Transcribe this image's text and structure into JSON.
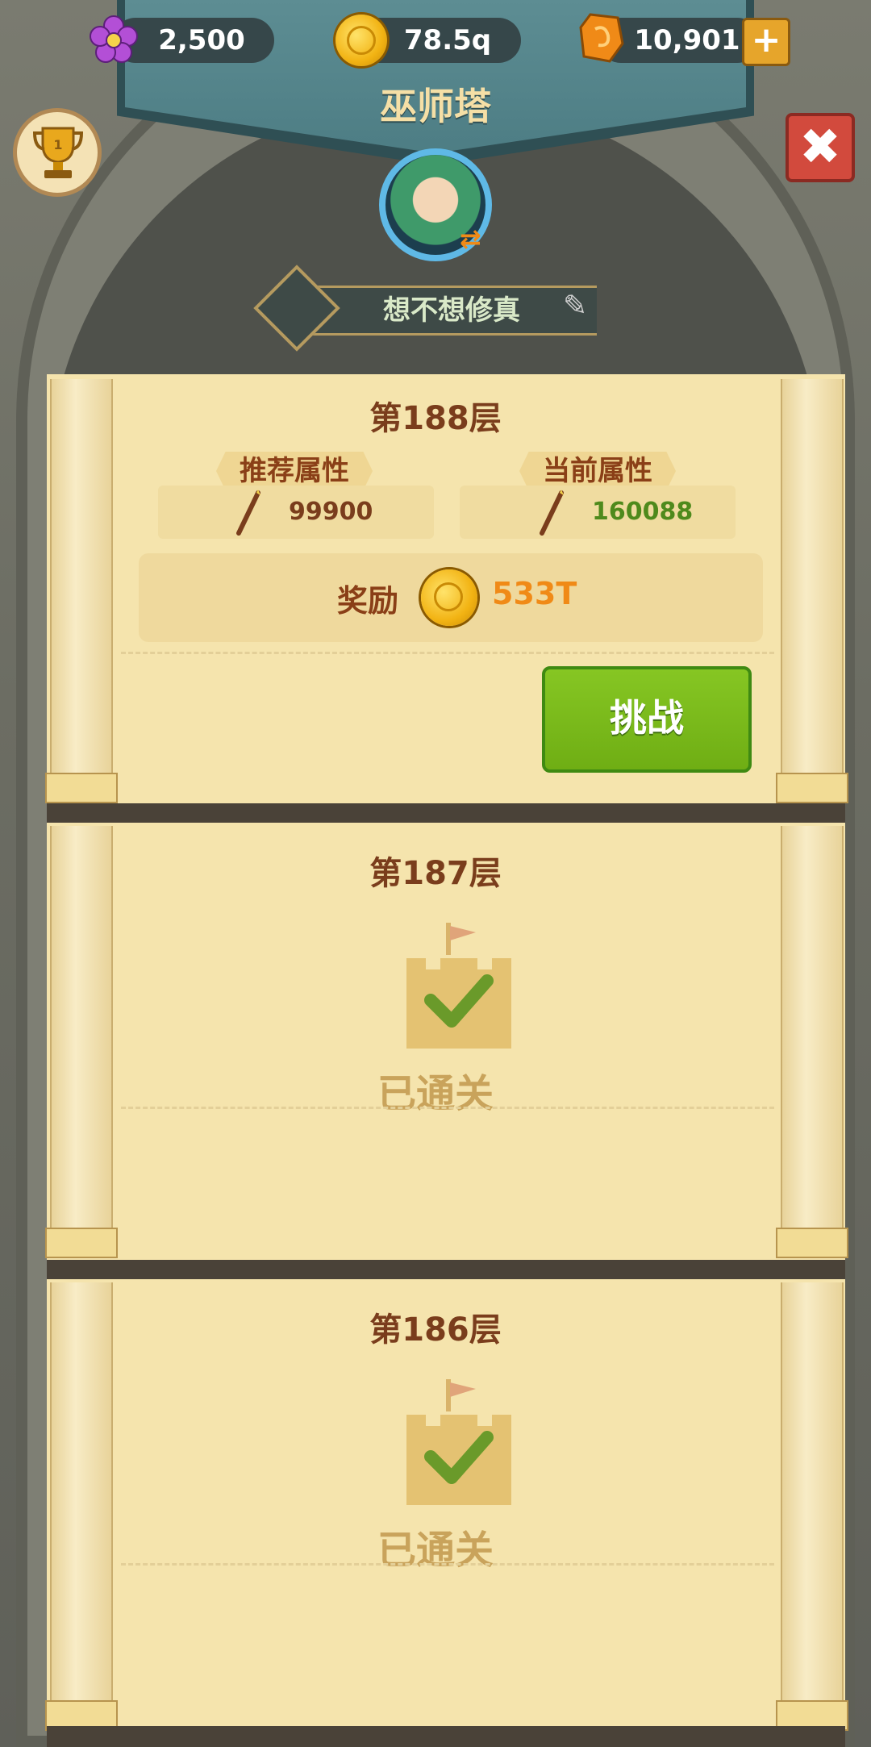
{
  "header": {
    "title": "巫师塔",
    "currencies": [
      {
        "icon": "flower-gem-icon",
        "value": "2,500"
      },
      {
        "icon": "gold-coin-icon",
        "value": "78.5q"
      },
      {
        "icon": "orange-gem-icon",
        "value": "10,901"
      }
    ],
    "add_label": "+",
    "close_label": "✖",
    "player_name": "想不想修真",
    "edit_icon": "✎"
  },
  "floors": [
    {
      "title": "第188层",
      "recommended_label": "推荐属性",
      "recommended_value": "99900",
      "current_label": "当前属性",
      "current_value": "160088",
      "reward_label": "奖励",
      "reward_value": "533T",
      "challenge_label": "挑战"
    },
    {
      "title": "第187层",
      "status": "已通关"
    },
    {
      "title": "第186层",
      "status": "已通关"
    }
  ],
  "colors": {
    "reward": "#f08a17",
    "current_value": "#4f8a1c",
    "challenge": "#7dbb1b"
  }
}
